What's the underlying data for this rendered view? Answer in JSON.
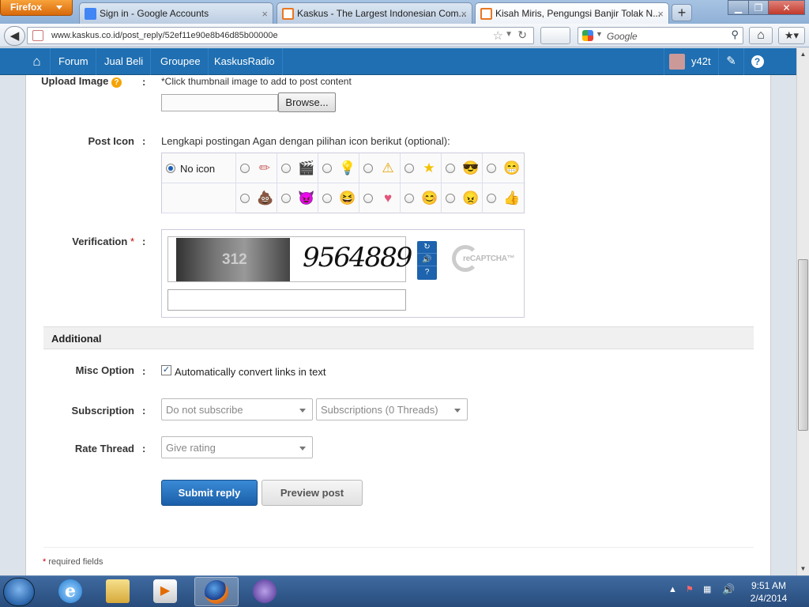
{
  "browser": {
    "app_menu": "Firefox",
    "tabs": [
      {
        "label": "Sign in - Google Accounts",
        "favicon": "google-icon",
        "color": "#4285f4"
      },
      {
        "label": "Kaskus - The Largest Indonesian Com...",
        "favicon": "kaskus-icon",
        "color": "#e87722"
      },
      {
        "label": "Kisah Miris, Pengungsi Banjir Tolak N...",
        "favicon": "kaskus-icon",
        "color": "#e87722"
      }
    ],
    "url": "www.kaskus.co.id/post_reply/52ef11e90e8b46d85b00000e",
    "search_placeholder": "Google"
  },
  "site_nav": {
    "items": [
      "Forum",
      "Jual Beli",
      "Groupee",
      "KaskusRadio"
    ],
    "username": "y42t",
    "help": "?",
    "brand_color": "#1f6fb2"
  },
  "form": {
    "upload": {
      "label": "Upload Image",
      "help_icon": "?",
      "hint": "*Click thumbnail image to add to post content",
      "browse": "Browse..."
    },
    "post_icon": {
      "label": "Post Icon",
      "description": "Lengkapi postingan Agan dengan pilihan icon berikut (optional):",
      "no_icon": "No icon",
      "selected": "No icon",
      "icons": [
        "pencil",
        "clapper",
        "lightbulb",
        "warning",
        "star",
        "cool",
        "grin",
        "poop",
        "devil",
        "laughing",
        "heart",
        "cute",
        "angry",
        "thumbs-up"
      ]
    },
    "verification": {
      "label": "Verification",
      "required": "*",
      "captcha_left_text": "312",
      "captcha_word": "9564889",
      "tools": [
        "↻",
        "🔊",
        "?"
      ],
      "logo": "reCAPTCHA™"
    },
    "additional": {
      "title": "Additional",
      "misc_label": "Misc Option",
      "misc_checkbox": "Automatically convert links in text",
      "misc_checked": true,
      "subscription_label": "Subscription",
      "subscription_value": "Do not subscribe",
      "subscription_threads": "Subscriptions (0 Threads)",
      "rate_label": "Rate Thread",
      "rate_value": "Give rating"
    },
    "submit": "Submit reply",
    "preview": "Preview post",
    "required_note": "required fields",
    "required_star": "*"
  },
  "colon": ":",
  "taskbar": {
    "time": "9:51 AM",
    "date": "2/4/2014"
  }
}
